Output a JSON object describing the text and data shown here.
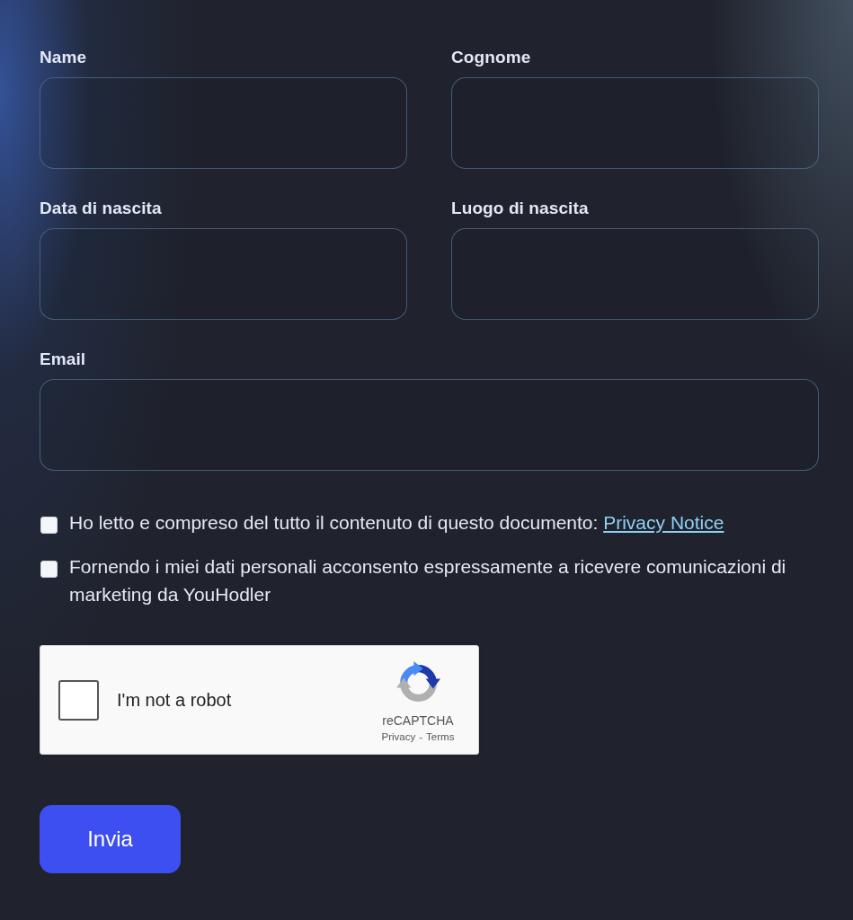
{
  "field_rows": [
    [
      {
        "label": "Name"
      },
      {
        "label": "Cognome"
      }
    ],
    [
      {
        "label": "Data di nascita"
      },
      {
        "label": "Luogo di nascita"
      }
    ],
    [
      {
        "label": "Email"
      }
    ]
  ],
  "consents": [
    {
      "text": "Ho letto e compreso del tutto il contenuto di questo documento:",
      "link": "Privacy Notice",
      "checked": false
    },
    {
      "text": "Fornendo i miei dati personali acconsento espressamente a ricevere comunicazioni di marketing da YouHodler",
      "checked": false
    }
  ],
  "recaptcha": {
    "label": "I'm not a robot",
    "checked": false,
    "brand": "reCAPTCHA",
    "links": [
      "Privacy",
      "Terms"
    ],
    "separator": "-"
  },
  "submit": {
    "label": "Invia"
  }
}
